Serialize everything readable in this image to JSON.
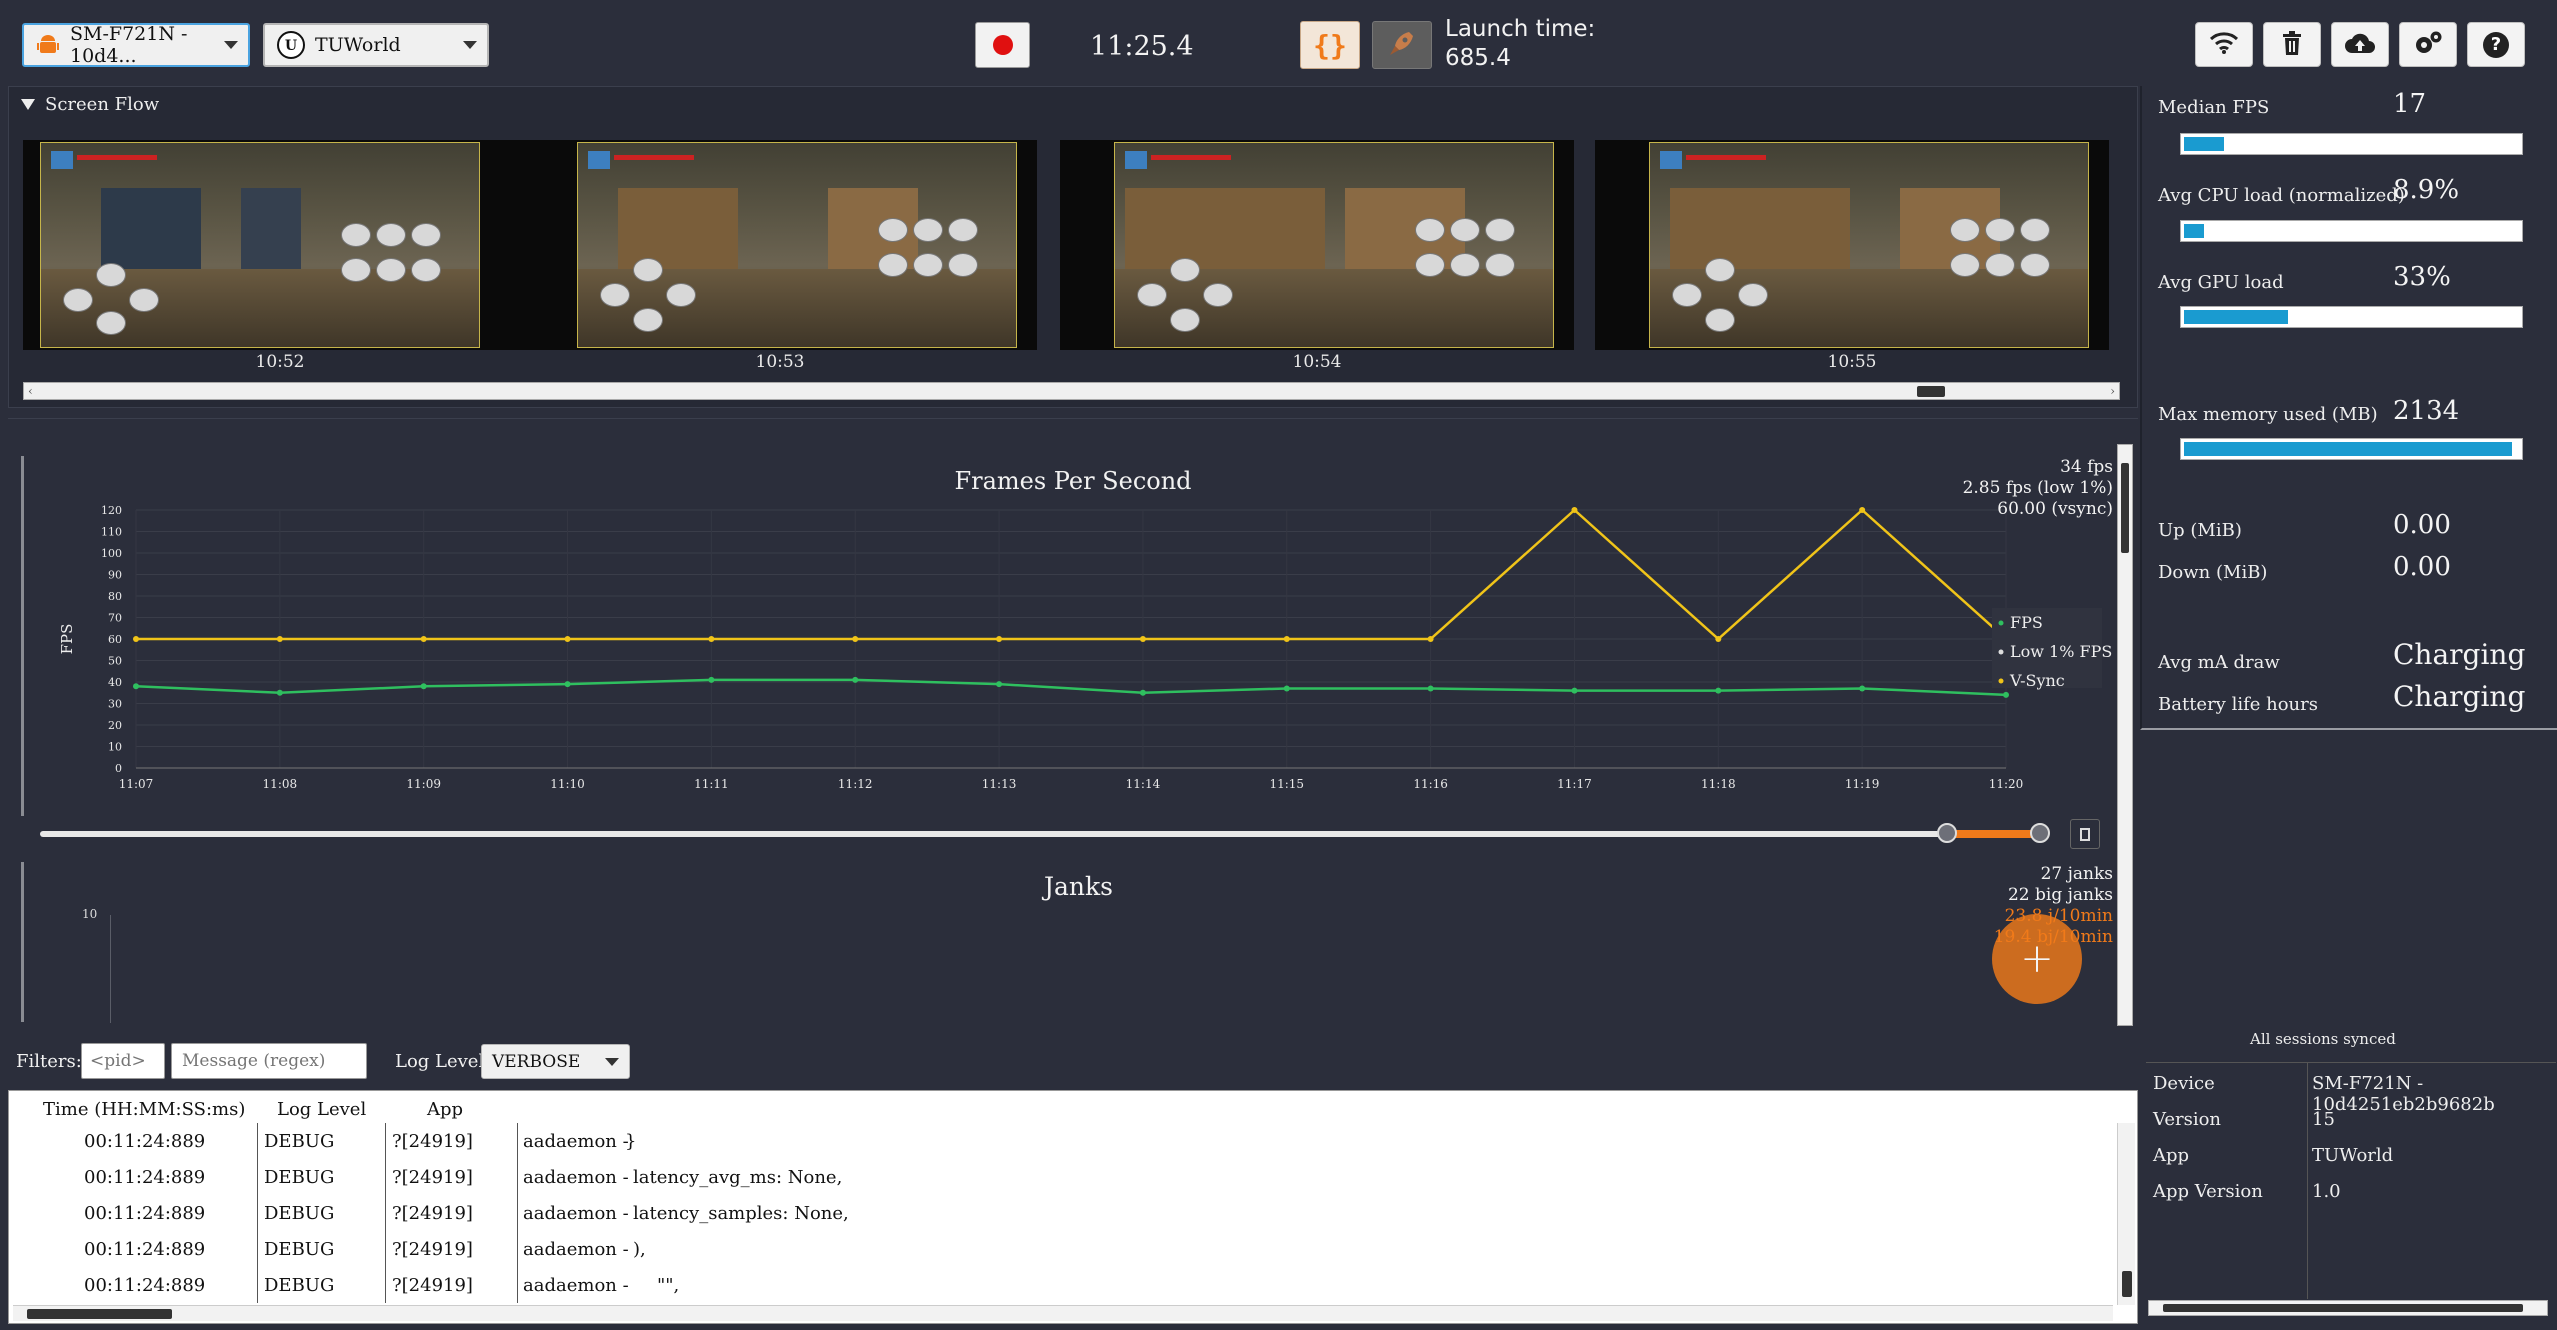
{
  "toolbar": {
    "device_label": "SM-F721N - 10d4...",
    "app_label": "TUWorld",
    "timer": "11:25.4",
    "launch_time_label": "Launch time:",
    "launch_time_value": "685.4",
    "json_icon_text": "{}"
  },
  "screen_flow": {
    "header": "Screen Flow",
    "thumbnails": [
      {
        "time": "10:52"
      },
      {
        "time": "10:53"
      },
      {
        "time": "10:54"
      },
      {
        "time": "10:55"
      }
    ]
  },
  "stats": {
    "median_fps": {
      "label": "Median FPS",
      "value": "17",
      "fill": 0.12
    },
    "cpu": {
      "label": "Avg CPU load (normalized)",
      "value": "8.9%",
      "fill": 0.06
    },
    "gpu": {
      "label": "Avg GPU load",
      "value": "33%",
      "fill": 0.31
    },
    "memory": {
      "label": "Max memory used (MB)",
      "value": "2134",
      "fill": 0.98
    },
    "up": {
      "label": "Up (MiB)",
      "value": "0.00"
    },
    "down": {
      "label": "Down (MiB)",
      "value": "0.00"
    },
    "ma_draw": {
      "label": "Avg mA draw",
      "value": "Charging"
    },
    "battery": {
      "label": "Battery life hours",
      "value": "Charging"
    }
  },
  "fps_panel": {
    "summary_1": "34 fps",
    "summary_2": "2.85 fps (low 1%)",
    "summary_3": "60.00 (vsync)"
  },
  "chart_data": {
    "type": "line",
    "title": "Frames Per Second",
    "ylabel": "FPS",
    "ylim": [
      0,
      120
    ],
    "yticks": [
      0,
      10,
      20,
      30,
      40,
      50,
      60,
      70,
      80,
      90,
      100,
      110,
      120
    ],
    "categories": [
      "11:07",
      "11:08",
      "11:09",
      "11:10",
      "11:11",
      "11:12",
      "11:13",
      "11:14",
      "11:15",
      "11:16",
      "11:17",
      "11:18",
      "11:19",
      "11:20"
    ],
    "series": [
      {
        "name": "FPS",
        "color": "#2fbf5f",
        "values": [
          38,
          35,
          38,
          39,
          41,
          41,
          39,
          35,
          37,
          37,
          36,
          36,
          37,
          34
        ]
      },
      {
        "name": "Low 1% FPS",
        "color": "#dddddd",
        "values": []
      },
      {
        "name": "V-Sync",
        "color": "#f0c419",
        "values": [
          60,
          60,
          60,
          60,
          60,
          60,
          60,
          60,
          60,
          60,
          120,
          60,
          120,
          60
        ]
      }
    ],
    "legend_position": "right",
    "grid": true
  },
  "janks": {
    "title": "Janks",
    "ytick": "10",
    "summary_1": "27 janks",
    "summary_2": "22 big janks",
    "summary_3": "23.8 j/10min",
    "summary_4": "19.4 bj/10min",
    "fab_symbol": "+"
  },
  "filters": {
    "label": "Filters:",
    "pid_placeholder": "<pid>",
    "message_placeholder": "Message (regex)",
    "log_level_label": "Log Level:",
    "log_level_value": "VERBOSE"
  },
  "log_table": {
    "headers": {
      "time": "Time (HH:MM:SS:ms)",
      "level": "Log Level",
      "app": "App"
    },
    "rows": [
      {
        "time": "00:11:24:889",
        "level": "DEBUG",
        "pid": "?[24919]",
        "tag": "aadaemon - ",
        "msg": "}"
      },
      {
        "time": "00:11:24:889",
        "level": "DEBUG",
        "pid": "?[24919]",
        "tag": "aadaemon - ",
        "msg": "latency_avg_ms: None,"
      },
      {
        "time": "00:11:24:889",
        "level": "DEBUG",
        "pid": "?[24919]",
        "tag": "aadaemon - ",
        "msg": "latency_samples: None,"
      },
      {
        "time": "00:11:24:889",
        "level": "DEBUG",
        "pid": "?[24919]",
        "tag": "aadaemon - ",
        "msg": "),"
      },
      {
        "time": "00:11:24:889",
        "level": "DEBUG",
        "pid": "?[24919]",
        "tag": "aadaemon - ",
        "msg": "\"\","
      }
    ]
  },
  "session": {
    "synced": "All sessions synced",
    "device_label": "Device",
    "device_value": "SM-F721N - 10d4251eb2b9682b",
    "version_label": "Version",
    "version_value": "15",
    "app_label": "App",
    "app_value": "TUWorld",
    "app_version_label": "App Version",
    "app_version_value": "1.0"
  },
  "colors": {
    "accent": "#f07a1a",
    "fps": "#2fbf5f",
    "vsync": "#f0c419",
    "bar": "#1a9bd0",
    "record": "#e01010"
  }
}
